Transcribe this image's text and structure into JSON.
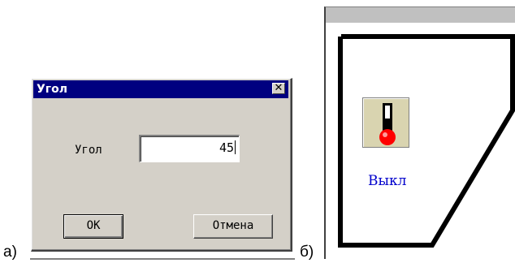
{
  "labels": {
    "a": "а)",
    "b": "б)"
  },
  "dialog": {
    "title": "Угол",
    "close_glyph": "✕",
    "field_label": "Угол",
    "field_value": "45",
    "ok_label": "OK",
    "cancel_label": "Отмена"
  },
  "panel": {
    "toggle_icon": "thermometer-icon",
    "toggle_label": "Выкл"
  },
  "colors": {
    "titlebar": "#000080",
    "dialog_bg": "#d4d0c8",
    "toggle_label": "#0000cc",
    "bulb": "#ff0000"
  }
}
